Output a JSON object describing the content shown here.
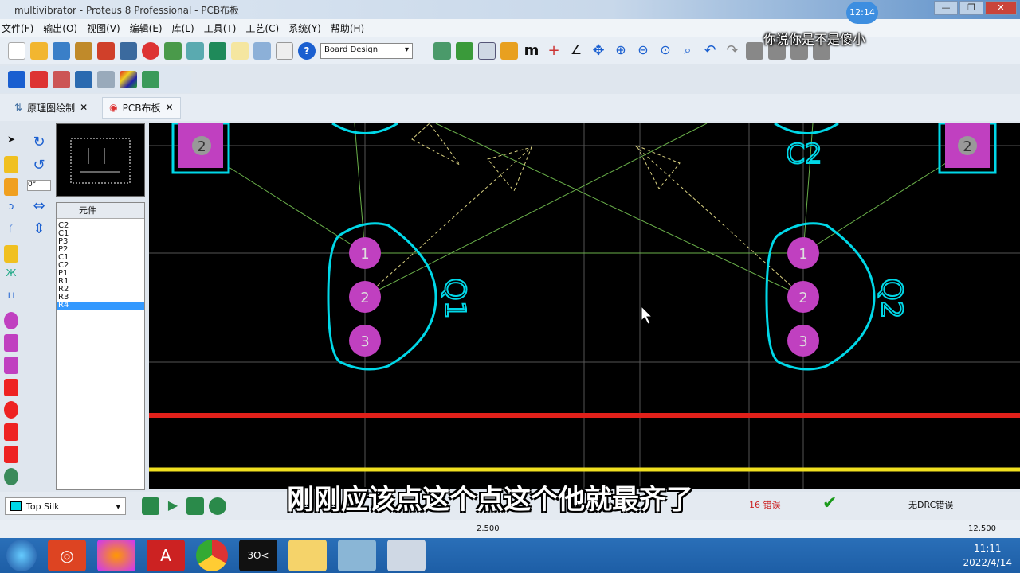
{
  "window": {
    "title": "multivibrator - Proteus 8 Professional - PCB布板",
    "timer_badge": "12:14",
    "watermark": "你说你是不是傻小"
  },
  "menu": [
    "文件(F)",
    "输出(O)",
    "视图(V)",
    "编辑(E)",
    "库(L)",
    "工具(T)",
    "工艺(C)",
    "系统(Y)",
    "帮助(H)"
  ],
  "toolbar": {
    "mode_select": "Board Design"
  },
  "tabs": [
    {
      "label": "原理图绘制"
    },
    {
      "label": "PCB布板"
    }
  ],
  "components": {
    "header": "元件",
    "items": [
      "C2",
      "C1",
      "P3",
      "P2",
      "C1",
      "C2",
      "P1",
      "R1",
      "R2",
      "R3",
      "R4"
    ],
    "selected": "R4"
  },
  "pcb": {
    "q1": "Q1",
    "q2": "Q2",
    "c2": "C2",
    "pads": [
      "1",
      "2",
      "3"
    ],
    "p_pad": "2"
  },
  "subtitle": "刚刚应该点这个点这个他就最齐了",
  "bottom": {
    "layer": "Top Silk",
    "errors": "16 错误",
    "drc": "无DRC错误"
  },
  "status": {
    "coord_x": "2.500",
    "coord_y": "12.500"
  },
  "taskbar": {
    "time": "11:11",
    "date": "2022/4/14"
  },
  "colors": {
    "pad": "#c040c0",
    "outline": "#00d8e8",
    "red_track": "#e0201a",
    "yellow_track": "#f0e020"
  }
}
